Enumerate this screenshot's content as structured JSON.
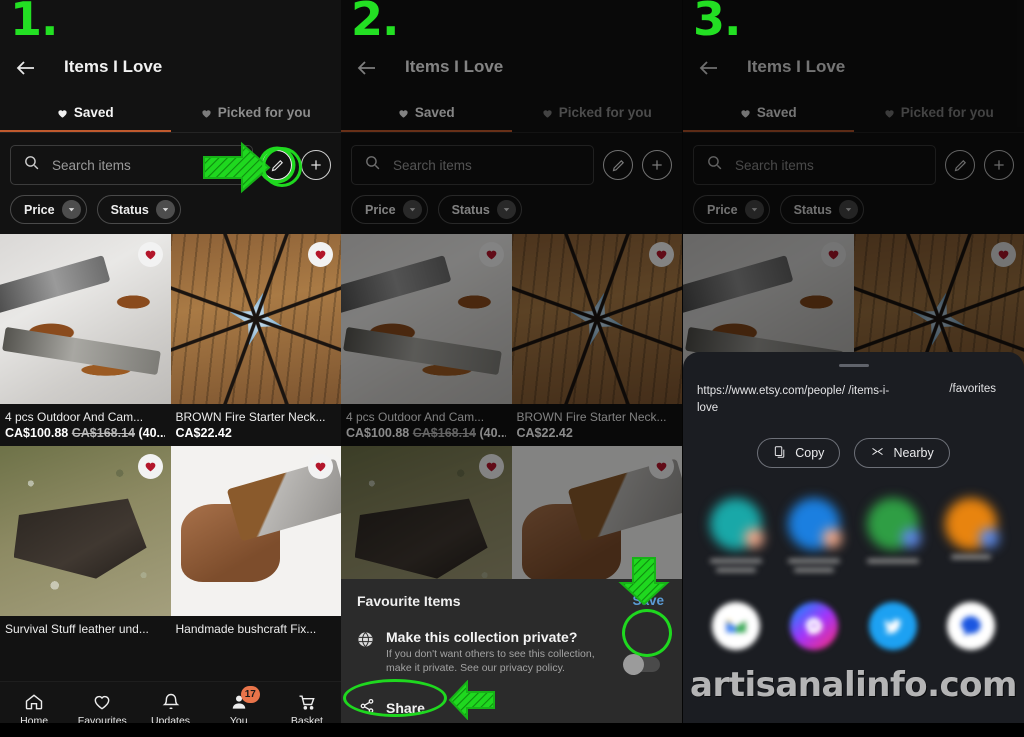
{
  "meta": {
    "watermark": "artisanalinfo.com",
    "accent_orange": "#c05a2e",
    "annotation_green": "#1fd81f",
    "badge_orange": "#e8744a",
    "link_blue": "#5b9bd5"
  },
  "steps": [
    "1.",
    "2.",
    "3."
  ],
  "app": {
    "title": "Items I Love",
    "back_icon": "back-arrow-icon",
    "tabs": [
      {
        "label": "Saved",
        "icon": "heart-icon",
        "active": true
      },
      {
        "label": "Picked for you",
        "icon": "heart-icon",
        "active": false
      }
    ],
    "search": {
      "placeholder": "Search items",
      "value": "",
      "icon": "search-icon"
    },
    "edit_button_icon": "pencil-icon",
    "add_button_icon": "plus-icon",
    "filters": [
      {
        "label": "Price",
        "icon": "chevron-down-icon"
      },
      {
        "label": "Status",
        "icon": "chevron-down-icon"
      }
    ],
    "products": [
      {
        "title": "4 pcs Outdoor And Cam...",
        "price": "CA$100.88",
        "old_price": "CA$168.14",
        "discount": "(40...",
        "art": "img-knives",
        "favorited": true
      },
      {
        "title": "BROWN Fire Starter Neck...",
        "price": "CA$22.42",
        "old_price": "",
        "discount": "",
        "art": "img-wood",
        "favorited": true
      },
      {
        "title": "Survival Stuff leather und...",
        "price": "",
        "old_price": "",
        "discount": "",
        "art": "img-ground",
        "favorited": true
      },
      {
        "title": "Handmade bushcraft Fix...",
        "price": "",
        "old_price": "",
        "discount": "",
        "art": "img-hand",
        "favorited": true
      }
    ],
    "bottom_nav": [
      {
        "label": "Home",
        "icon": "home-icon",
        "badge": ""
      },
      {
        "label": "Favourites",
        "icon": "heart-outline-icon",
        "badge": ""
      },
      {
        "label": "Updates",
        "icon": "bell-icon",
        "badge": ""
      },
      {
        "label": "You",
        "icon": "person-icon",
        "badge": "17"
      },
      {
        "label": "Basket",
        "icon": "cart-icon",
        "badge": ""
      }
    ]
  },
  "sheet_collection": {
    "title": "Favourite Items",
    "save_label": "Save",
    "privacy_icon": "globe-icon",
    "privacy_question": "Make this collection private?",
    "privacy_description": "If you don't want others to see this collection, make it private. See our privacy policy.",
    "toggle_state": "off",
    "share_label": "Share",
    "share_icon": "share-icon"
  },
  "sheet_share": {
    "grabber": "drag-handle",
    "url_main": "https://www.etsy.com/people/ /items-i-love",
    "url_fragment": "/favorites",
    "actions": [
      {
        "label": "Copy",
        "icon": "copy-icon"
      },
      {
        "label": "Nearby",
        "icon": "nearby-share-icon"
      }
    ],
    "contacts": [
      {
        "color": "#19a8a8",
        "accent": "#e07a5f",
        "name_blurred": true
      },
      {
        "color": "#1b7fe0",
        "accent": "#e07a5f",
        "name_blurred": true
      },
      {
        "color": "#2f9e44",
        "accent": "#2f6fe0",
        "name_blurred": true
      },
      {
        "color": "#e8840f",
        "accent": "#2f6fe0",
        "name_blurred": true
      }
    ],
    "apps": [
      {
        "name": "gmail-icon",
        "bg": "#ffffff",
        "glyph": "M",
        "glyph_color": "#d93025"
      },
      {
        "name": "messenger-icon",
        "bg": "#c236d8",
        "glyph": "⚡",
        "glyph_color": "#ffffff"
      },
      {
        "name": "twitter-icon",
        "bg": "#1da1f2",
        "glyph": "✓",
        "glyph_color": "#ffffff"
      },
      {
        "name": "messages-icon",
        "bg": "#ffffff",
        "glyph": "●",
        "glyph_color": "#1b56e0"
      }
    ]
  }
}
